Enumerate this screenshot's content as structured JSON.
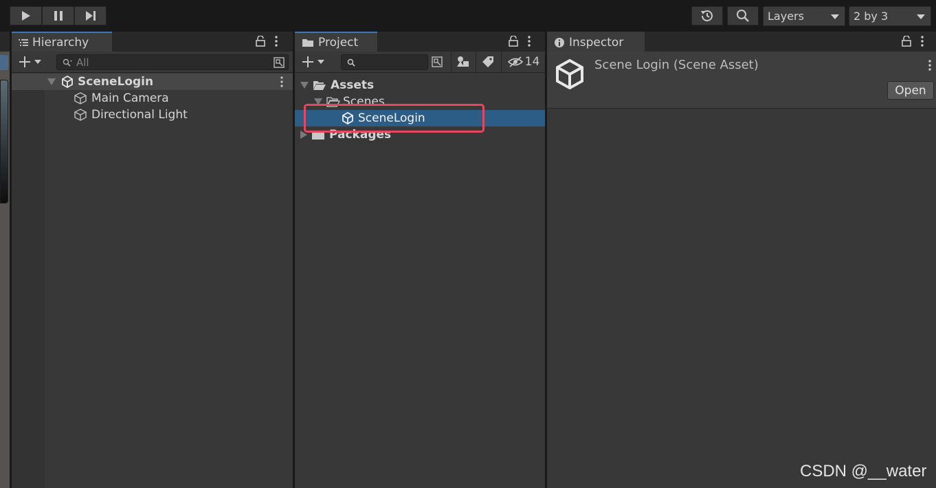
{
  "toolbar": {
    "play_icon": "play-icon",
    "pause_icon": "pause-icon",
    "step_icon": "step-icon",
    "history_icon": "history-icon",
    "search_icon": "search-icon",
    "layers_label": "Layers",
    "layout_label": "2 by 3"
  },
  "hierarchy": {
    "tab_label": "Hierarchy",
    "search_placeholder": "All",
    "scene_name": "SceneLogin",
    "items": [
      {
        "label": "Main Camera"
      },
      {
        "label": "Directional Light"
      }
    ]
  },
  "project": {
    "tab_label": "Project",
    "hidden_count": "14",
    "tree": {
      "assets": "Assets",
      "scenes": "Scenes",
      "scene_login": "SceneLogin",
      "packages": "Packages"
    }
  },
  "inspector": {
    "tab_label": "Inspector",
    "title": "Scene Login (Scene Asset)",
    "open_button": "Open"
  },
  "watermark": "CSDN @__water",
  "colors": {
    "selection": "#2c5d87",
    "highlight_box": "#e5485e",
    "active_tab_accent": "#3a79bb"
  }
}
